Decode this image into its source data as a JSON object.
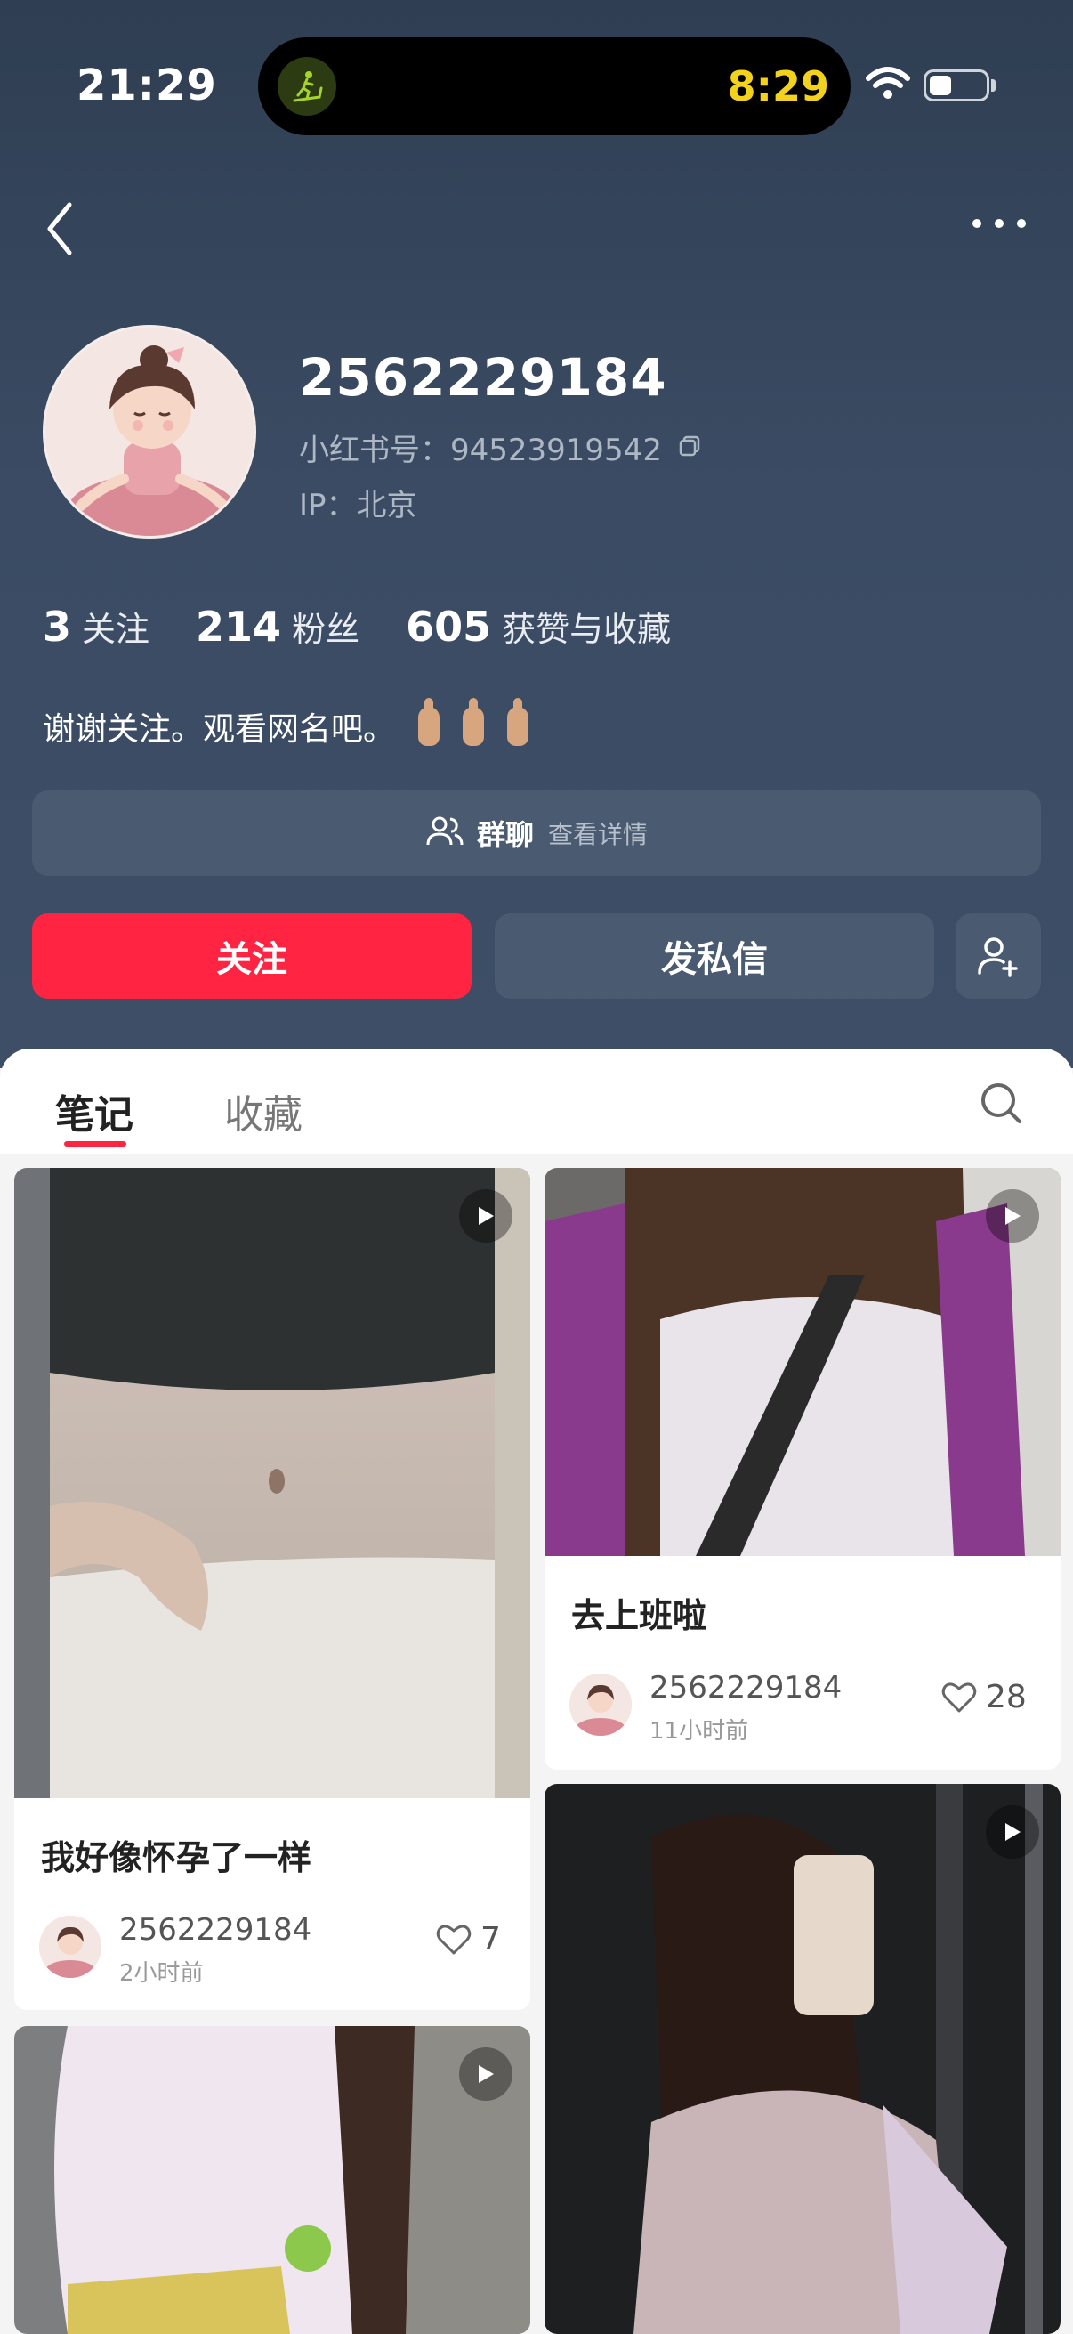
{
  "status_bar": {
    "time": "21:29",
    "timer": "8:29"
  },
  "profile": {
    "username": "2562229184",
    "rid_label": "小红书号：94523919542",
    "ip_label": "IP：北京",
    "stats": [
      {
        "num": "3",
        "label": "关注"
      },
      {
        "num": "214",
        "label": "粉丝"
      },
      {
        "num": "605",
        "label": "获赞与收藏"
      }
    ],
    "bio": "谢谢关注。观看网名吧。"
  },
  "group_chat": {
    "title": "群聊",
    "subtitle": "查看详情"
  },
  "actions": {
    "follow": "关注",
    "message": "发私信"
  },
  "tabs": [
    {
      "label": "笔记",
      "active": true
    },
    {
      "label": "收藏",
      "active": false
    }
  ],
  "notes": [
    {
      "title": "我好像怀孕了一样",
      "author": "2562229184",
      "time": "2小时前",
      "likes": "7"
    },
    {
      "title": "去上班啦",
      "author": "2562229184",
      "time": "11小时前",
      "likes": "28"
    }
  ],
  "colors": {
    "accent": "#ff2442",
    "hero_bg": "#344459",
    "button_bg": "#4a5a71"
  }
}
